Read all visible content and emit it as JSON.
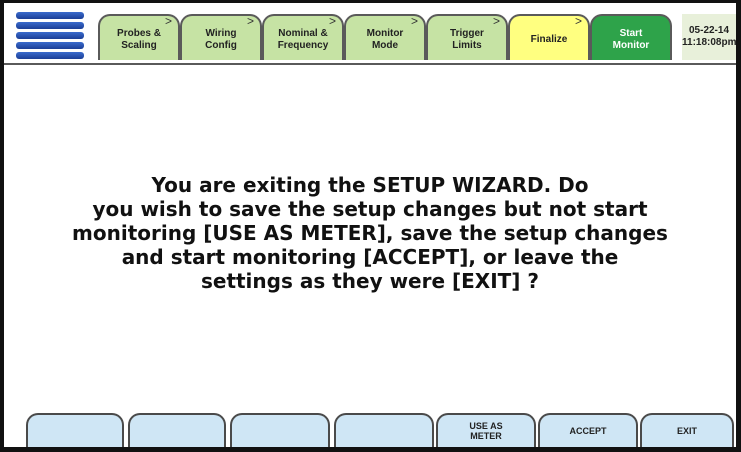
{
  "header": {
    "tabs": [
      {
        "label": "Probes &\nScaling",
        "state": "done"
      },
      {
        "label": "Wiring\nConfig",
        "state": "done"
      },
      {
        "label": "Nominal &\nFrequency",
        "state": "done"
      },
      {
        "label": "Monitor\nMode",
        "state": "done"
      },
      {
        "label": "Trigger\nLimits",
        "state": "done"
      },
      {
        "label": "Finalize",
        "state": "current"
      },
      {
        "label": "Start\nMonitor",
        "state": "action"
      }
    ],
    "date": "05-22-14",
    "time": "11:18:08pm"
  },
  "message": "You are exiting the SETUP WIZARD.  Do\nyou wish to save the setup changes but not start\nmonitoring [USE AS METER], save the setup changes\nand start monitoring [ACCEPT], or leave the\nsettings as they were [EXIT] ?",
  "softkeys": [
    "",
    "",
    "",
    "",
    "USE AS\nMETER",
    "ACCEPT",
    "EXIT"
  ],
  "colors": {
    "tab_done": "#c6e3a4",
    "tab_current": "#ffff80",
    "tab_action": "#2ea34a",
    "softkey": "#cfe6f5",
    "logo": "#1c3f96"
  }
}
